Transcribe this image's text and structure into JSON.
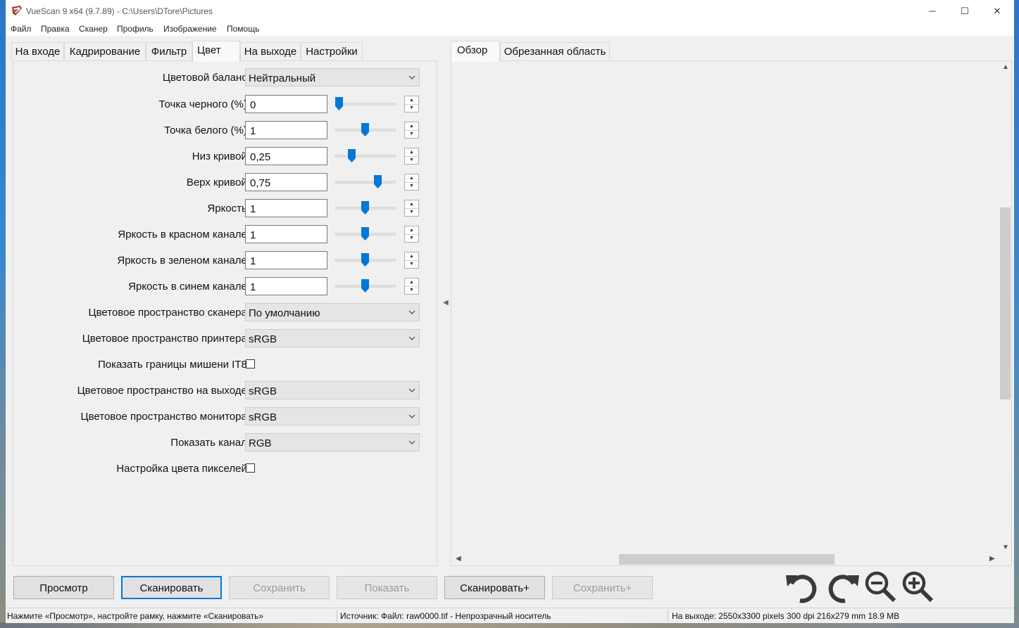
{
  "window": {
    "title": "VueScan 9 x64 (9.7.89) - C:\\Users\\DTore\\Pictures",
    "minimize_symbol": "─",
    "maximize_symbol": "☐",
    "close_symbol": "✕"
  },
  "menu": [
    "Файл",
    "Правка",
    "Сканер",
    "Профиль",
    "Изображение",
    "Помощь"
  ],
  "left_tabs": [
    "На входе",
    "Кадрирование",
    "Фильтр",
    "Цвет",
    "На выходе",
    "Настройки"
  ],
  "active_left_tab": "Цвет",
  "right_tabs": [
    "Обзор",
    "Обрезанная область"
  ],
  "active_right_tab": "Обзор",
  "color_settings": {
    "color_balance": {
      "label": "Цветовой баланс:",
      "value": "Нейтральный"
    },
    "black_point": {
      "label": "Точка черного (%):",
      "value": "0",
      "slider": 0.0
    },
    "white_point": {
      "label": "Точка белого (%):",
      "value": "1",
      "slider": 0.5
    },
    "curve_low": {
      "label": "Низ кривой:",
      "value": "0,25",
      "slider": 0.25
    },
    "curve_high": {
      "label": "Верх кривой:",
      "value": "0,75",
      "slider": 0.75
    },
    "brightness": {
      "label": "Яркость:",
      "value": "1",
      "slider": 0.5
    },
    "red_brightness": {
      "label": "Яркость в красном канале:",
      "value": "1",
      "slider": 0.5
    },
    "green_brightness": {
      "label": "Яркость в зеленом канале:",
      "value": "1",
      "slider": 0.5
    },
    "blue_brightness": {
      "label": "Яркость в синем канале:",
      "value": "1",
      "slider": 0.5
    },
    "scanner_color_space": {
      "label": "Цветовое пространство сканера:",
      "value": "По умолчанию"
    },
    "printer_color_space": {
      "label": "Цветовое пространство принтера:",
      "value": "sRGB"
    },
    "show_it8_bounds": {
      "label": "Показать границы мишени IT8:",
      "checked": false
    },
    "output_color_space": {
      "label": "Цветовое пространство на выходе:",
      "value": "sRGB"
    },
    "monitor_color_space": {
      "label": "Цветовое пространство монитора:",
      "value": "sRGB"
    },
    "show_channel": {
      "label": "Показать канал:",
      "value": "RGB"
    },
    "pixel_color_setup": {
      "label": "Настройка цвета пикселей:",
      "checked": false
    }
  },
  "buttons": {
    "preview": "Просмотр",
    "scan": "Сканировать",
    "save": "Сохранить",
    "show": "Показать",
    "scan_plus": "Сканировать+",
    "save_plus": "Сохранить+"
  },
  "toolbar_icons": [
    "rotate-left-icon",
    "rotate-right-icon",
    "zoom-out-icon",
    "zoom-in-icon"
  ],
  "status": {
    "hint": "Нажмите «Просмотр», настройте рамку, нажмите «Сканировать»",
    "source": "Источник: Файл: raw0000.tif - Непрозрачный носитель",
    "output": "На выходе: 2550x3300 pixels 300 dpi 216x279 mm 18.9 MB"
  },
  "colors": {
    "accent": "#0078d7",
    "slider_thumb": "#0078d7"
  }
}
